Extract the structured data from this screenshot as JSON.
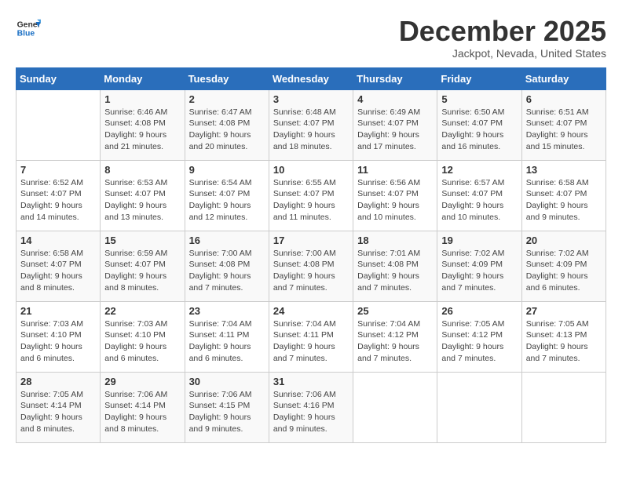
{
  "logo": {
    "line1": "General",
    "line2": "Blue"
  },
  "title": "December 2025",
  "subtitle": "Jackpot, Nevada, United States",
  "headers": [
    "Sunday",
    "Monday",
    "Tuesday",
    "Wednesday",
    "Thursday",
    "Friday",
    "Saturday"
  ],
  "weeks": [
    [
      {
        "day": "",
        "info": ""
      },
      {
        "day": "1",
        "info": "Sunrise: 6:46 AM\nSunset: 4:08 PM\nDaylight: 9 hours\nand 21 minutes."
      },
      {
        "day": "2",
        "info": "Sunrise: 6:47 AM\nSunset: 4:08 PM\nDaylight: 9 hours\nand 20 minutes."
      },
      {
        "day": "3",
        "info": "Sunrise: 6:48 AM\nSunset: 4:07 PM\nDaylight: 9 hours\nand 18 minutes."
      },
      {
        "day": "4",
        "info": "Sunrise: 6:49 AM\nSunset: 4:07 PM\nDaylight: 9 hours\nand 17 minutes."
      },
      {
        "day": "5",
        "info": "Sunrise: 6:50 AM\nSunset: 4:07 PM\nDaylight: 9 hours\nand 16 minutes."
      },
      {
        "day": "6",
        "info": "Sunrise: 6:51 AM\nSunset: 4:07 PM\nDaylight: 9 hours\nand 15 minutes."
      }
    ],
    [
      {
        "day": "7",
        "info": "Sunrise: 6:52 AM\nSunset: 4:07 PM\nDaylight: 9 hours\nand 14 minutes."
      },
      {
        "day": "8",
        "info": "Sunrise: 6:53 AM\nSunset: 4:07 PM\nDaylight: 9 hours\nand 13 minutes."
      },
      {
        "day": "9",
        "info": "Sunrise: 6:54 AM\nSunset: 4:07 PM\nDaylight: 9 hours\nand 12 minutes."
      },
      {
        "day": "10",
        "info": "Sunrise: 6:55 AM\nSunset: 4:07 PM\nDaylight: 9 hours\nand 11 minutes."
      },
      {
        "day": "11",
        "info": "Sunrise: 6:56 AM\nSunset: 4:07 PM\nDaylight: 9 hours\nand 10 minutes."
      },
      {
        "day": "12",
        "info": "Sunrise: 6:57 AM\nSunset: 4:07 PM\nDaylight: 9 hours\nand 10 minutes."
      },
      {
        "day": "13",
        "info": "Sunrise: 6:58 AM\nSunset: 4:07 PM\nDaylight: 9 hours\nand 9 minutes."
      }
    ],
    [
      {
        "day": "14",
        "info": "Sunrise: 6:58 AM\nSunset: 4:07 PM\nDaylight: 9 hours\nand 8 minutes."
      },
      {
        "day": "15",
        "info": "Sunrise: 6:59 AM\nSunset: 4:07 PM\nDaylight: 9 hours\nand 8 minutes."
      },
      {
        "day": "16",
        "info": "Sunrise: 7:00 AM\nSunset: 4:08 PM\nDaylight: 9 hours\nand 7 minutes."
      },
      {
        "day": "17",
        "info": "Sunrise: 7:00 AM\nSunset: 4:08 PM\nDaylight: 9 hours\nand 7 minutes."
      },
      {
        "day": "18",
        "info": "Sunrise: 7:01 AM\nSunset: 4:08 PM\nDaylight: 9 hours\nand 7 minutes."
      },
      {
        "day": "19",
        "info": "Sunrise: 7:02 AM\nSunset: 4:09 PM\nDaylight: 9 hours\nand 7 minutes."
      },
      {
        "day": "20",
        "info": "Sunrise: 7:02 AM\nSunset: 4:09 PM\nDaylight: 9 hours\nand 6 minutes."
      }
    ],
    [
      {
        "day": "21",
        "info": "Sunrise: 7:03 AM\nSunset: 4:10 PM\nDaylight: 9 hours\nand 6 minutes."
      },
      {
        "day": "22",
        "info": "Sunrise: 7:03 AM\nSunset: 4:10 PM\nDaylight: 9 hours\nand 6 minutes."
      },
      {
        "day": "23",
        "info": "Sunrise: 7:04 AM\nSunset: 4:11 PM\nDaylight: 9 hours\nand 6 minutes."
      },
      {
        "day": "24",
        "info": "Sunrise: 7:04 AM\nSunset: 4:11 PM\nDaylight: 9 hours\nand 7 minutes."
      },
      {
        "day": "25",
        "info": "Sunrise: 7:04 AM\nSunset: 4:12 PM\nDaylight: 9 hours\nand 7 minutes."
      },
      {
        "day": "26",
        "info": "Sunrise: 7:05 AM\nSunset: 4:12 PM\nDaylight: 9 hours\nand 7 minutes."
      },
      {
        "day": "27",
        "info": "Sunrise: 7:05 AM\nSunset: 4:13 PM\nDaylight: 9 hours\nand 7 minutes."
      }
    ],
    [
      {
        "day": "28",
        "info": "Sunrise: 7:05 AM\nSunset: 4:14 PM\nDaylight: 9 hours\nand 8 minutes."
      },
      {
        "day": "29",
        "info": "Sunrise: 7:06 AM\nSunset: 4:14 PM\nDaylight: 9 hours\nand 8 minutes."
      },
      {
        "day": "30",
        "info": "Sunrise: 7:06 AM\nSunset: 4:15 PM\nDaylight: 9 hours\nand 9 minutes."
      },
      {
        "day": "31",
        "info": "Sunrise: 7:06 AM\nSunset: 4:16 PM\nDaylight: 9 hours\nand 9 minutes."
      },
      {
        "day": "",
        "info": ""
      },
      {
        "day": "",
        "info": ""
      },
      {
        "day": "",
        "info": ""
      }
    ]
  ]
}
